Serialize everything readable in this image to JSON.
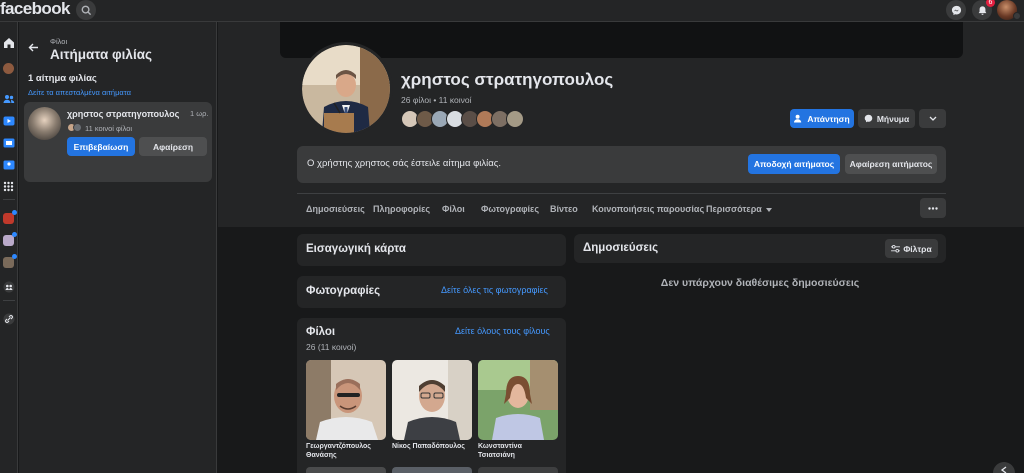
{
  "topbar": {
    "logo": "facebook",
    "notif_count": "6"
  },
  "panel": {
    "crumb": "Φίλοι",
    "title": "Αιτήματα φιλίας",
    "count_label": "1 αίτημα φιλίας",
    "sent_link": "Δείτε τα απεσταλμένα αιτήματα",
    "request": {
      "name": "χρηστος στρατηγοπουλος",
      "time": "1 ωρ.",
      "mutual": "11 κοινοί φίλοι",
      "confirm": "Επιβεβαίωση",
      "remove": "Αφαίρεση"
    }
  },
  "profile": {
    "name": "χρηστος στρατηγοπουλος",
    "friends_line": "26 φίλοι • 11 κοινοί",
    "respond_label": "Απάντηση",
    "message_label": "Μήνυμα"
  },
  "request_bar": {
    "text": "Ο χρήστης χρηστος σάς έστειλε αίτημα φιλίας.",
    "accept_label": "Αποδοχή αιτήματος",
    "decline_label": "Αφαίρεση αιτήματος"
  },
  "tabs": [
    "Δημοσιεύσεις",
    "Πληροφορίες",
    "Φίλοι",
    "Φωτογραφίες",
    "Βίντεο",
    "Κοινοποιήσεις παρουσίας",
    "Περισσότερα"
  ],
  "intro": {
    "title": "Εισαγωγική κάρτα"
  },
  "photos": {
    "title": "Φωτογραφίες",
    "see_all": "Δείτε όλες τις φωτογραφίες"
  },
  "friends": {
    "title": "Φίλοι",
    "count": "26 (11 κοινοί)",
    "see_all": "Δείτε όλους τους φίλους",
    "items": [
      {
        "name": "Γεωργαντζόπουλος Θανάσης"
      },
      {
        "name": "Νίκος Παπαδόπουλος"
      },
      {
        "name": "Κωνσταντίνα Τσιατσιάνη"
      }
    ]
  },
  "posts": {
    "title": "Δημοσιεύσεις",
    "filter_label": "Φίλτρα",
    "empty": "Δεν υπάρχουν διαθέσιμες δημοσιεύσεις"
  },
  "colors": {
    "accent": "#2374e1",
    "link": "#4599ff",
    "card": "#242526",
    "bg": "#18191a"
  }
}
